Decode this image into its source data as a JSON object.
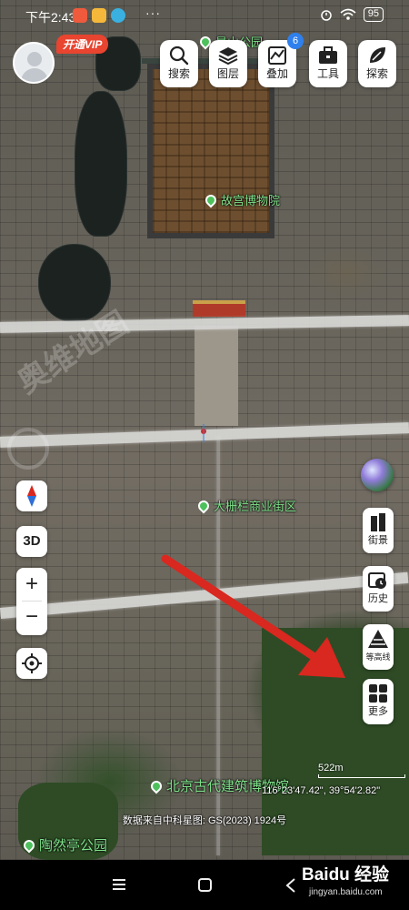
{
  "status_bar": {
    "time": "下午2:43",
    "dots": "···",
    "battery": "95"
  },
  "vip_badge": "开通VIP",
  "toolbar": {
    "search": "搜索",
    "layers": "图层",
    "overlay": "叠加",
    "overlay_badge": "6",
    "tools": "工具",
    "explore": "探索"
  },
  "left_controls": {
    "mode_3d": "3D",
    "zoom_in": "+",
    "zoom_out": "−"
  },
  "right_controls": {
    "street": "街景",
    "history": "历史",
    "contour": "等高线",
    "more": "更多"
  },
  "map_labels": {
    "top_park": "景山公园",
    "palace": "故宫博物院",
    "street": "大栅栏商业街区",
    "museum": "北京古代建筑博物馆",
    "park": "陶然亭公园"
  },
  "watermark": "奥维地图",
  "scale": "522m",
  "coordinates": "116°23'47.42\", 39°54'2.82\"",
  "data_source": "数据来自中科星图: GS(2023) 1924号",
  "baidu": {
    "logo": "Baidu 经验",
    "url": "jingyan.baidu.com"
  },
  "colors": {
    "arrow": "#d8281f",
    "poi_green": "#4ec15d",
    "vip_red": "#e8442f",
    "badge_blue": "#2f80ed"
  },
  "icons": [
    "search-icon",
    "layers-icon",
    "overlay-icon",
    "toolbox-icon",
    "explore-icon",
    "compass-icon",
    "locate-icon",
    "street-view-icon",
    "history-icon",
    "contour-icon",
    "more-icon"
  ]
}
